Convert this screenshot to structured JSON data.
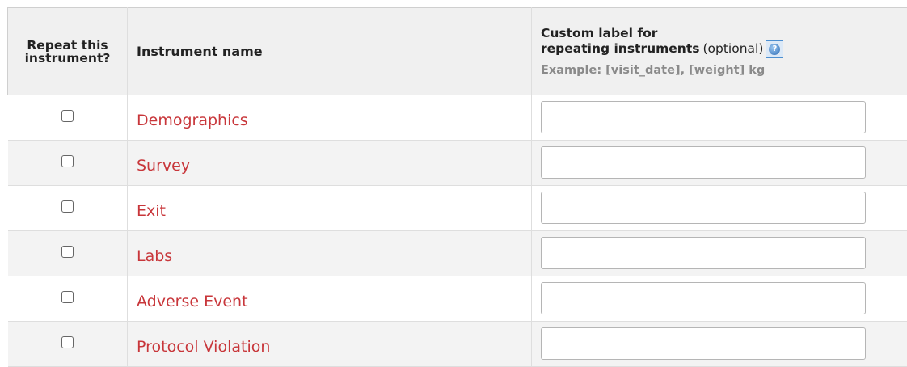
{
  "header": {
    "repeat_line1": "Repeat this",
    "repeat_line2": "instrument?",
    "name": "Instrument name",
    "label_line1": "Custom label for",
    "label_line2_bold": "repeating instruments",
    "label_line2_optional": "(optional)",
    "label_example": "Example: [visit_date], [weight] kg",
    "help_icon": "help-question-icon"
  },
  "rows": [
    {
      "name": "Demographics",
      "checked": false,
      "label_value": ""
    },
    {
      "name": "Survey",
      "checked": false,
      "label_value": ""
    },
    {
      "name": "Exit",
      "checked": false,
      "label_value": ""
    },
    {
      "name": "Labs",
      "checked": false,
      "label_value": ""
    },
    {
      "name": "Adverse Event",
      "checked": false,
      "label_value": ""
    },
    {
      "name": "Protocol Violation",
      "checked": false,
      "label_value": ""
    }
  ],
  "colors": {
    "link": "#c8363a",
    "header_bg": "#f0f0f0",
    "row_alt_bg": "#f3f3f3"
  }
}
